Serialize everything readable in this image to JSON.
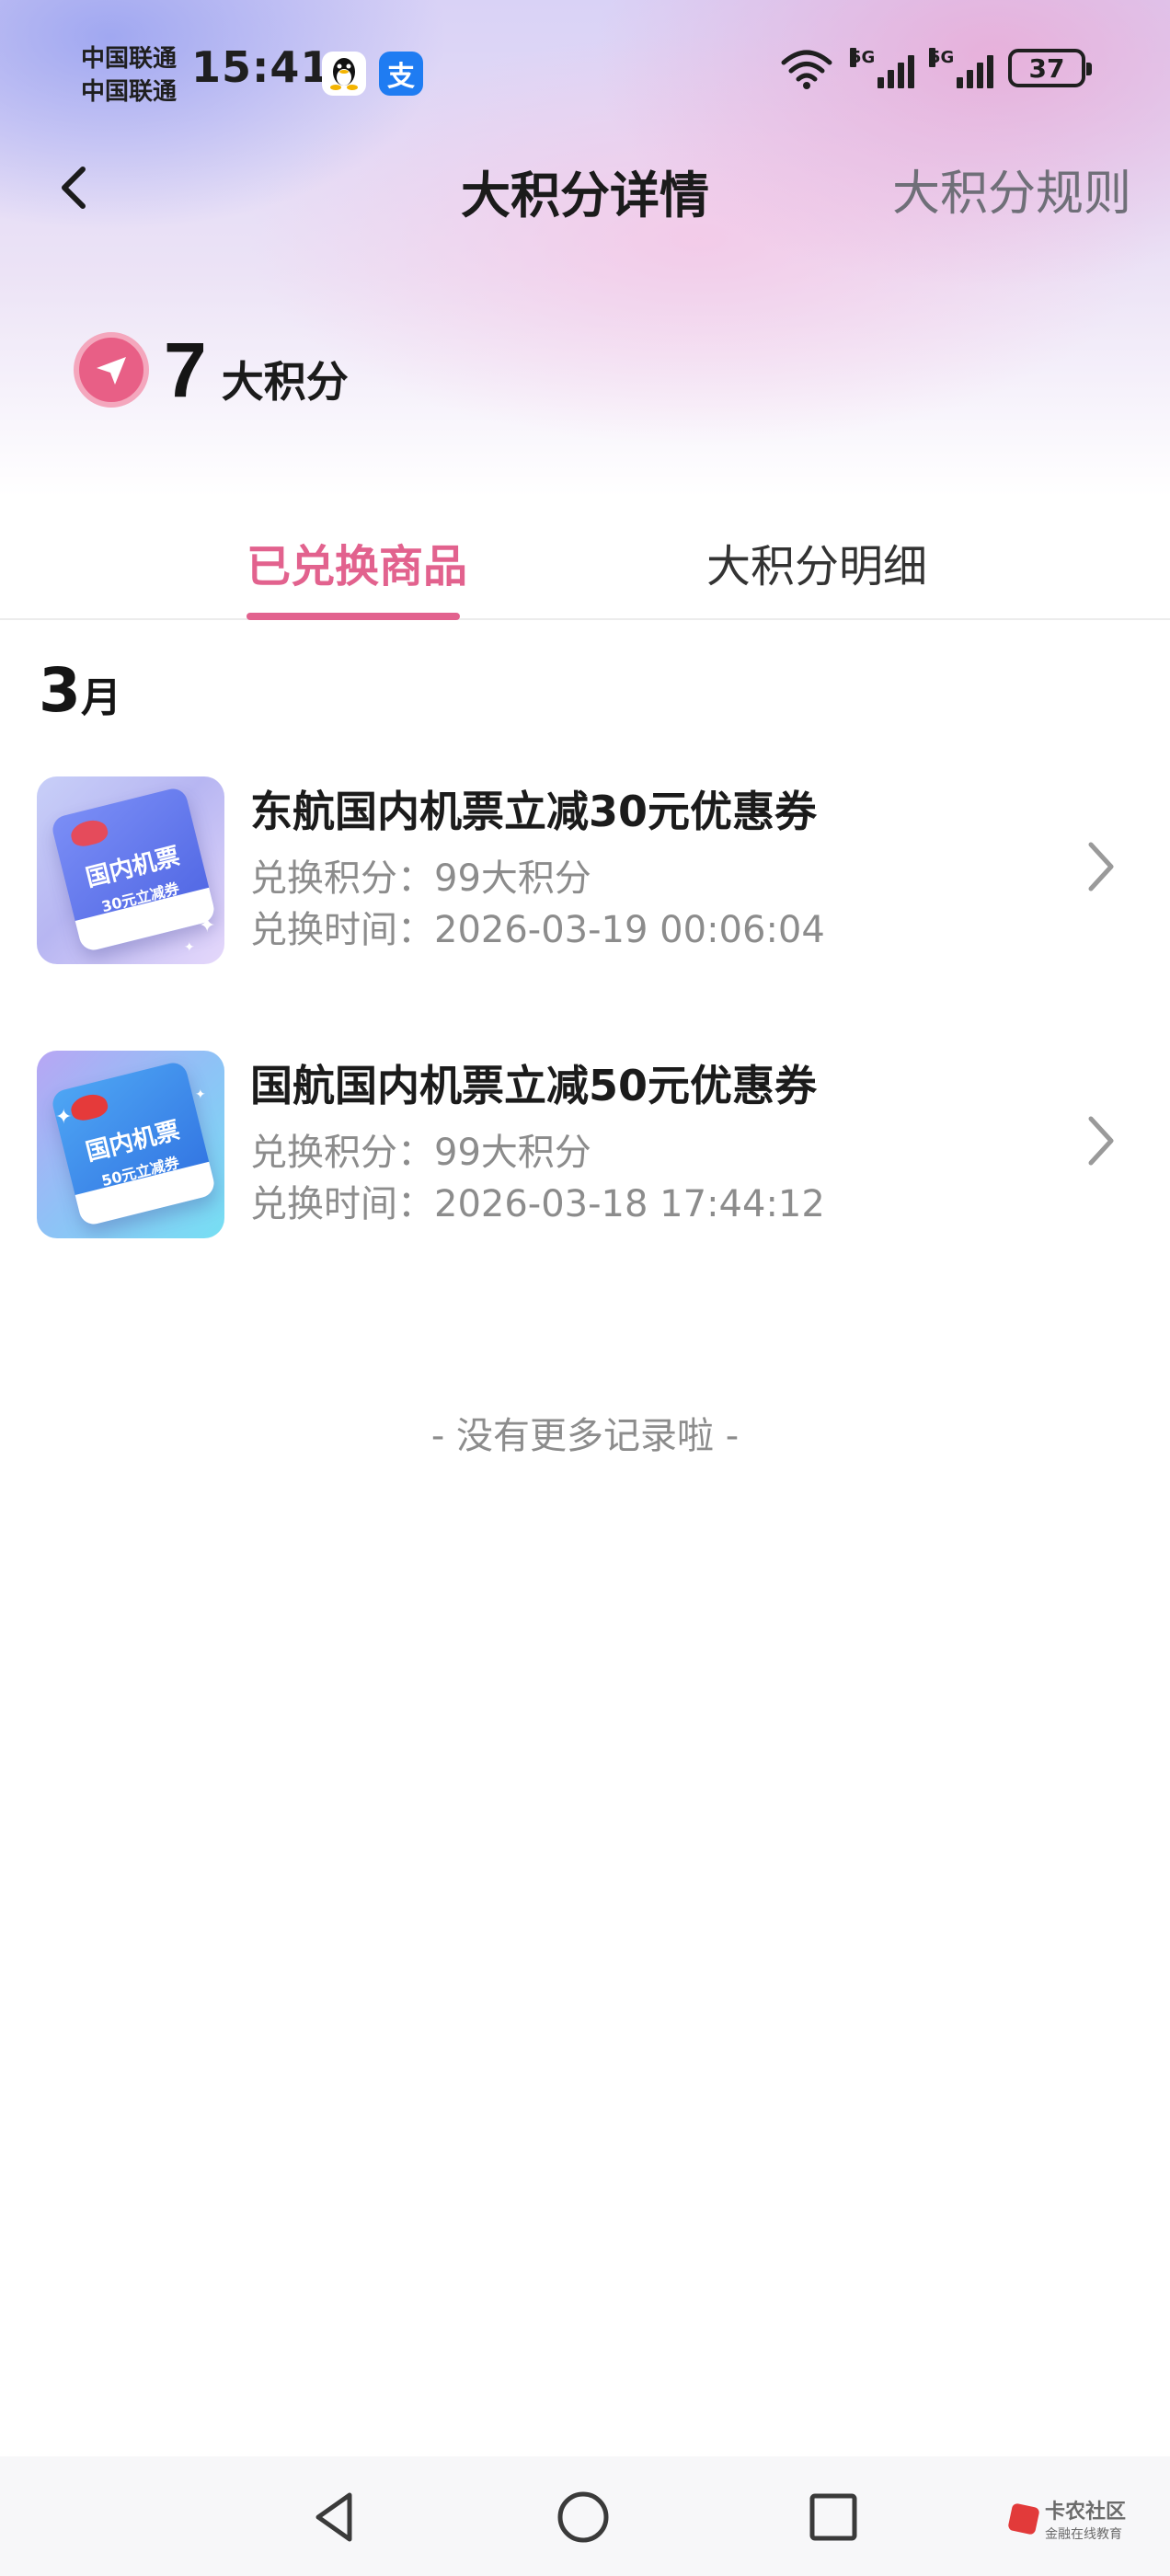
{
  "status_bar": {
    "carrier_1": "中国联通",
    "carrier_2": "中国联通",
    "time": "15:41",
    "notification_icons": [
      "qq-icon",
      "alipay-icon"
    ],
    "alipay_glyph": "支",
    "network_labels": [
      "5G",
      "5G"
    ],
    "battery": "37"
  },
  "header": {
    "title": "大积分详情",
    "rules_label": "大积分规则",
    "back_icon": "chevron-left-icon"
  },
  "points": {
    "value": "7",
    "unit": "大积分",
    "icon": "points-badge-icon"
  },
  "tabs": [
    {
      "label": "已兑换商品",
      "active": true
    },
    {
      "label": "大积分明细",
      "active": false
    }
  ],
  "records": {
    "month_number": "3",
    "month_unit": "月",
    "items": [
      {
        "title": "东航国内机票立减30元优惠券",
        "points_label": "兑换积分：99大积分",
        "time_label": "兑换时间：2026-03-19 00:06:04",
        "thumb_title": "国内机票",
        "thumb_subtitle": "30元立减券"
      },
      {
        "title": "国航国内机票立减50元优惠券",
        "points_label": "兑换积分：99大积分",
        "time_label": "兑换时间：2026-03-18 17:44:12",
        "thumb_title": "国内机票",
        "thumb_subtitle": "50元立减券"
      }
    ],
    "end_hint": "- 没有更多记录啦 -"
  },
  "navbar": {
    "watermark_title": "卡农社区",
    "watermark_subtitle": "金融在线教育"
  },
  "colors": {
    "accent": "#e2628e",
    "text_primary": "#1b1b1b",
    "text_secondary": "#8c8c8c"
  }
}
